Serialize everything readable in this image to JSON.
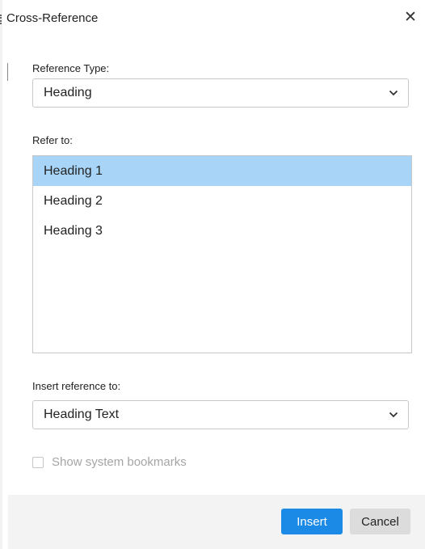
{
  "dialog": {
    "title": "Cross-Reference",
    "close_icon": "close-icon"
  },
  "reference_type": {
    "label": "Reference Type:",
    "value": "Heading"
  },
  "refer_to": {
    "label": "Refer to:",
    "items": [
      "Heading 1",
      "Heading 2",
      "Heading 3"
    ],
    "selected": "Heading 1"
  },
  "insert_reference": {
    "label": "Insert reference to:",
    "value": "Heading Text"
  },
  "show_system_bookmarks": {
    "label": "Show system bookmarks",
    "checked": false,
    "disabled": true
  },
  "buttons": {
    "insert": "Insert",
    "cancel": "Cancel"
  },
  "colors": {
    "accent": "#1a8ae6",
    "selection": "#a8d4f7",
    "footer": "#f3f3f3"
  }
}
